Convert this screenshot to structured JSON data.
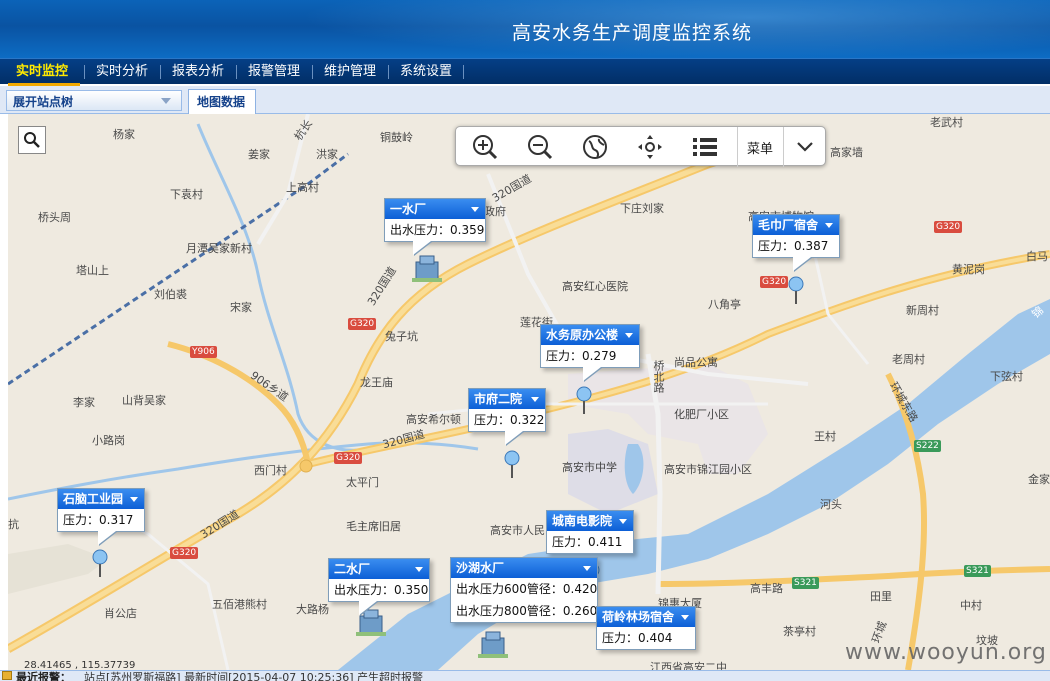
{
  "header": {
    "title": "高安水务生产调度监控系统"
  },
  "nav": [
    {
      "label": "实时监控",
      "active": true
    },
    {
      "label": "实时分析"
    },
    {
      "label": "报表分析"
    },
    {
      "label": "报警管理"
    },
    {
      "label": "维护管理"
    },
    {
      "label": "系统设置"
    }
  ],
  "sidebar": {
    "select_label": "展开站点树"
  },
  "tabs": {
    "map_tab": "地图数据"
  },
  "toolbar": {
    "menu_label": "菜单"
  },
  "map_labels": {
    "l1": "杨家",
    "l2": "姜家",
    "l3": "洪家",
    "l4": "下袁村",
    "l5": "上高村",
    "l6": "桥头周",
    "l7": "月潭吴家新村",
    "l8": "塔山上",
    "l9": "刘伯裘",
    "l10": "宋家",
    "l11": "兔子坑",
    "l12": "龙王庙",
    "l13": "李家",
    "l14": "山背吴家",
    "l15": "小路岗",
    "l16": "西门村",
    "l17": "太平门",
    "l18": "毛主席旧居",
    "l19": "高安市人民",
    "l20": "五佰港熊村",
    "l21": "大路杨",
    "l22": "肖公店",
    "l23": "铜鼓岭",
    "l24": "老武村",
    "l25": "高家墙",
    "l26": "下庄刘家",
    "l27": "高安红心医院",
    "l28": "莲花街",
    "l29": "八角亭",
    "l30": "尚品公寓",
    "l31": "化肥厂小区",
    "l32": "高安市中学",
    "l33": "高安市锦江园小区",
    "l34": "高安希尔顿",
    "l35": "王村",
    "l36": "河头",
    "l37": "黄泥岗",
    "l38": "新周村",
    "l39": "老周村",
    "l40": "下弦村",
    "l41": "白马",
    "l42": "金家",
    "l43": "田里",
    "l44": "中村",
    "l45": "茶亭村",
    "l46": "坟坡",
    "l47": "锦惠大厦",
    "l48": "江西省高安二中",
    "l49": "高丰路",
    "l50": "320国道",
    "l51": "320国道",
    "l52": "320国道",
    "l53": "320国道",
    "l54": "906乡道",
    "l55": "桥北路",
    "l56": "环城东路",
    "l57": "环城",
    "l58": "杭长",
    "l59": "锦",
    "l60": "抗",
    "l61": "政府",
    "l62": "高安市博物馆"
  },
  "road_shields": {
    "g1": "G320",
    "g2": "G320",
    "g3": "G320",
    "g4": "G320",
    "g5": "G320",
    "y1": "Y906",
    "s1": "S222",
    "s2": "S321",
    "s3": "S321"
  },
  "stations": {
    "s1": {
      "name": "一水厂",
      "rows": [
        "出水压力：0.359"
      ]
    },
    "s2": {
      "name": "毛巾厂宿舍",
      "rows": [
        "压力：0.387"
      ]
    },
    "s3": {
      "name": "水务原办公楼",
      "rows": [
        "压力：0.279"
      ]
    },
    "s4": {
      "name": "市府二院",
      "rows": [
        "压力：0.322"
      ]
    },
    "s5": {
      "name": "石脑工业园",
      "rows": [
        "压力：0.317"
      ]
    },
    "s6": {
      "name": "城南电影院",
      "rows": [
        "压力：0.411"
      ]
    },
    "s7": {
      "name": "二水厂",
      "rows": [
        "出水压力：0.350"
      ]
    },
    "s8": {
      "name": "沙湖水厂",
      "rows": [
        "出水压力600管径：0.420",
        "出水压力800管径：0.260"
      ]
    },
    "s9": {
      "name": "荷岭林场宿舍",
      "rows": [
        "压力：0.404"
      ]
    }
  },
  "coord_text": "28.41465 , 115.37739",
  "status": {
    "alarm_label": "最近报警：",
    "alarm_text": "站点[苏州罗斯福路] 最新时间[2015-04-07 10:25:36] 产生超时报警"
  },
  "watermark": "www.wooyun.org",
  "colors": {
    "header": "#0b5cb0",
    "nav": "#033775",
    "accent": "#ffea00",
    "popup_header": "#1a6fe0",
    "water": "#9fc6ea"
  }
}
